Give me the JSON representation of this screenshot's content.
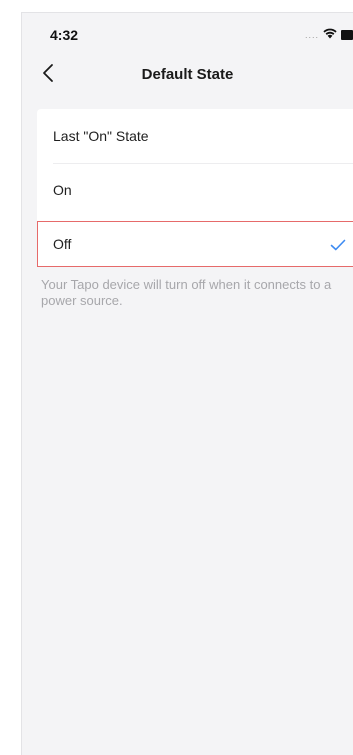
{
  "status_bar": {
    "time": "4:32",
    "signal": "....",
    "icons": [
      "wifi-icon",
      "battery-icon"
    ]
  },
  "nav": {
    "title": "Default State",
    "back_icon": "chevron-left-icon"
  },
  "options": [
    {
      "label": "Last \"On\" State",
      "selected": false
    },
    {
      "label": "On",
      "selected": false
    },
    {
      "label": "Off",
      "selected": true
    }
  ],
  "description": "Your Tapo device will turn off when it connects to a power source.",
  "colors": {
    "accent": "#3d8bf2",
    "selected_border": "#e66a6a",
    "background": "#f4f4f6",
    "secondary_text": "#a7a7ab"
  }
}
